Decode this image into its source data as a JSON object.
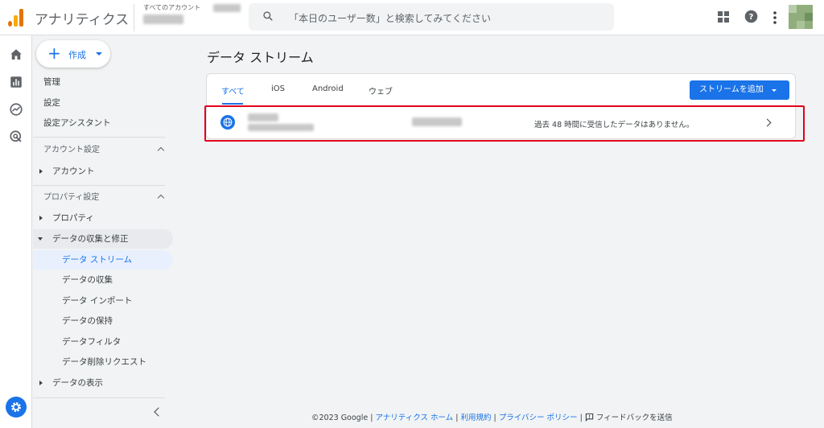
{
  "app": {
    "title": "アナリティクス"
  },
  "account": {
    "label": "すべてのアカウント"
  },
  "search": {
    "placeholder": "「本日のユーザー数」と検索してみてください"
  },
  "topbar": {
    "icons": [
      "apps-icon",
      "help-icon",
      "more-vert-icon",
      "avatar"
    ]
  },
  "rail": {
    "icons": [
      "home-icon",
      "reports-icon",
      "explore-icon",
      "advertising-icon",
      "settings-icon"
    ]
  },
  "nav": {
    "create_label": "作成",
    "top_items": [
      "管理",
      "設定",
      "設定アシスタント"
    ],
    "account_section": "アカウント設定",
    "account_item": "アカウント",
    "property_section": "プロパティ設定",
    "property_item": "プロパティ",
    "data_collection": "データの収集と修正",
    "sub_items": [
      "データ ストリーム",
      "データの収集",
      "データ インポート",
      "データの保持",
      "データフィルタ",
      "データ削除リクエスト"
    ],
    "data_display": "データの表示"
  },
  "main": {
    "title": "データ ストリーム",
    "tabs": [
      "すべて",
      "iOS",
      "Android",
      "ウェブ"
    ],
    "add_stream_label": "ストリームを追加",
    "stream": {
      "status": "過去 48 時間に受信したデータはありません。"
    }
  },
  "footer": {
    "copyright": "©2023 Google",
    "sep": "|",
    "links": [
      "アナリティクス ホーム",
      "利用規約",
      "プライバシー ポリシー"
    ],
    "feedback": "フィードバックを送信"
  },
  "colors": {
    "accent": "#1a73e8",
    "highlight": "#e3001b",
    "logo_orange": "#f9ab00",
    "logo_dark": "#e37400"
  }
}
